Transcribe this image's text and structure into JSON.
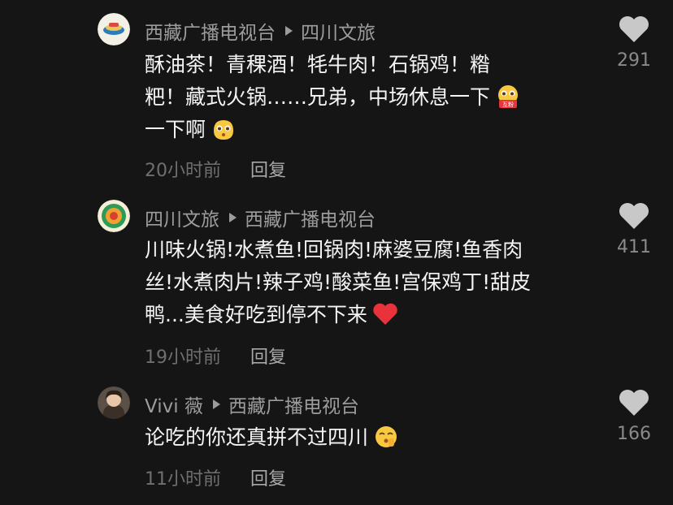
{
  "comments": [
    {
      "author": "西藏广播电视台",
      "reply_to": "四川文旅",
      "lines": [
        "酥油茶！青稞酒！牦牛肉！石锅鸡！糌",
        "粑！藏式火锅……兄弟，中场休息一下",
        "一下啊"
      ],
      "time": "20小时前",
      "reply_label": "回复",
      "likes": "291",
      "emoji_badge": "互粉"
    },
    {
      "author": "四川文旅",
      "reply_to": "西藏广播电视台",
      "lines": [
        "川味火锅!水煮鱼!回锅肉!麻婆豆腐!鱼香肉",
        "丝!水煮肉片!辣子鸡!酸菜鱼!宫保鸡丁!甜皮",
        "鸭...美食好吃到停不下来"
      ],
      "time": "19小时前",
      "reply_label": "回复",
      "likes": "411"
    },
    {
      "author": "Vivi 薇",
      "reply_to": "西藏广播电视台",
      "lines": [
        "论吃的你还真拼不过四川"
      ],
      "time": "11小时前",
      "reply_label": "回复",
      "likes": "166"
    }
  ],
  "icons": {
    "like": "heart-icon",
    "reply_arrow": "play-triangle-icon"
  },
  "colors": {
    "background": "#151515",
    "text": "#f4f4f4",
    "muted": "#9c9c9c",
    "heart": "#c8c8c8",
    "red_heart": "#e8333c"
  }
}
